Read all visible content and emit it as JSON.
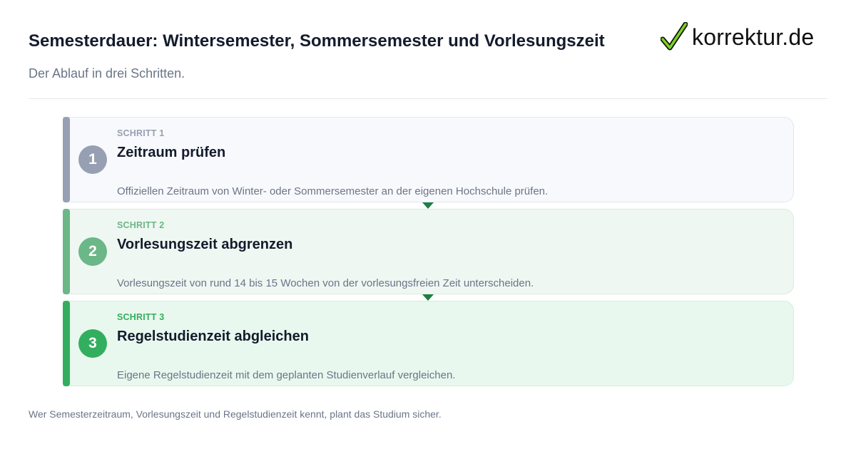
{
  "header": {
    "title": "Semesterdauer: Wintersemester, Sommersemester und Vorlesungszeit",
    "subtitle": "Der Ablauf in drei Schritten."
  },
  "logo": {
    "text": "korrektur.de",
    "icon": "green-checkmark-icon"
  },
  "steps": [
    {
      "number": "1",
      "kicker": "SCHRITT 1",
      "title": "Zeitraum prüfen",
      "description": "Offiziellen Zeitraum von Winter- oder Sommersemester an der eigenen Hochschule prüfen.",
      "color": "#979fb2"
    },
    {
      "number": "2",
      "kicker": "SCHRITT 2",
      "title": "Vorlesungszeit abgrenzen",
      "description": "Vorlesungszeit von rund 14 bis 15 Wochen von der vorlesungsfreien Zeit unterscheiden.",
      "color": "#6bb787"
    },
    {
      "number": "3",
      "kicker": "SCHRITT 3",
      "title": "Regelstudienzeit abgleichen",
      "description": "Eigene Regelstudienzeit mit dem geplanten Studienverlauf vergleichen.",
      "color": "#33ae5f"
    }
  ],
  "connector_color": "#1f7f44",
  "footer": {
    "note": "Wer Semesterzeitraum, Vorlesungszeit und Regelstudienzeit kennt, plant das Studium sicher."
  }
}
